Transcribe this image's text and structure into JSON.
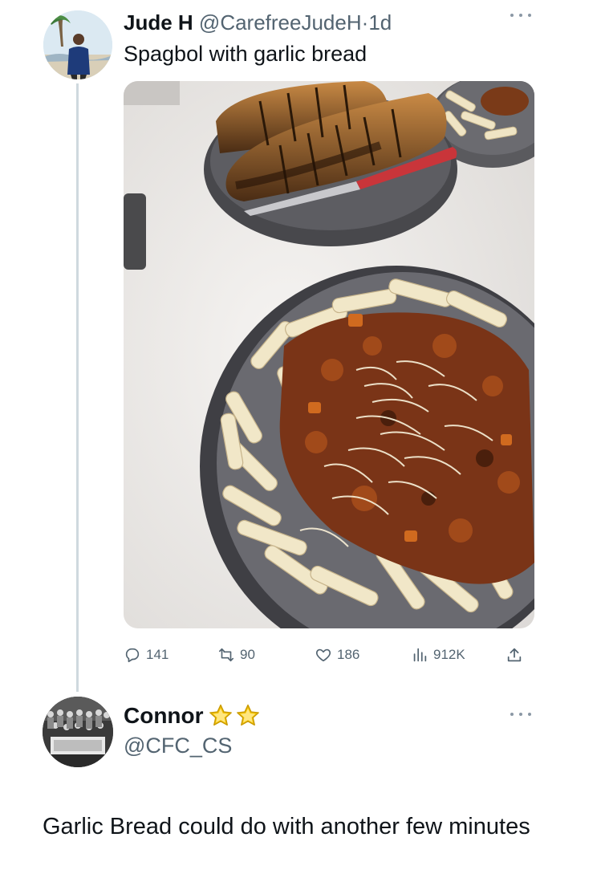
{
  "original_tweet": {
    "author_name": "Jude H",
    "author_handle": "@CarefreeJudeH",
    "separator": "·",
    "time_ago": "1d",
    "text": "Spagbol with garlic bread",
    "avatar_icon": "profile-photo",
    "more_icon": "ellipsis-icon",
    "image_icon": "food-photo"
  },
  "metrics": {
    "replies": "141",
    "retweets": "90",
    "likes": "186",
    "views": "912K",
    "reply_icon": "reply-icon",
    "retweet_icon": "retweet-icon",
    "like_icon": "heart-icon",
    "views_icon": "views-bar-chart-icon",
    "share_icon": "share-icon"
  },
  "reply_tweet": {
    "author_name": "Connor",
    "author_handle": "@CFC_CS",
    "badge_icon": "star-icon",
    "text": "Garlic Bread could do with another few minutes",
    "avatar_icon": "profile-photo",
    "more_icon": "ellipsis-icon"
  },
  "colors": {
    "text_primary": "#0f1419",
    "text_secondary": "#536471",
    "thread_line": "#cfd9de",
    "star_fill": "#f5c400",
    "star_outline": "#c99a00"
  }
}
